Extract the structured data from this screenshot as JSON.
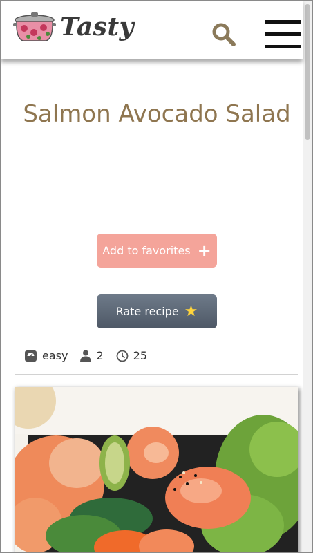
{
  "brand": {
    "name": "Tasty",
    "logo_icon": "pot-icon"
  },
  "header": {
    "search_icon": "search-icon",
    "menu_icon": "hamburger-menu-icon"
  },
  "recipe": {
    "title": "Salmon Avocado Salad",
    "favorite_label": "Add to favorites",
    "rate_label": "Rate recipe",
    "difficulty": "easy",
    "servings": "2",
    "time": "25"
  },
  "colors": {
    "title": "#8f7650",
    "favorite_button": "#f4a49a",
    "rate_button": "#5d6876",
    "star": "#ffd43b"
  }
}
